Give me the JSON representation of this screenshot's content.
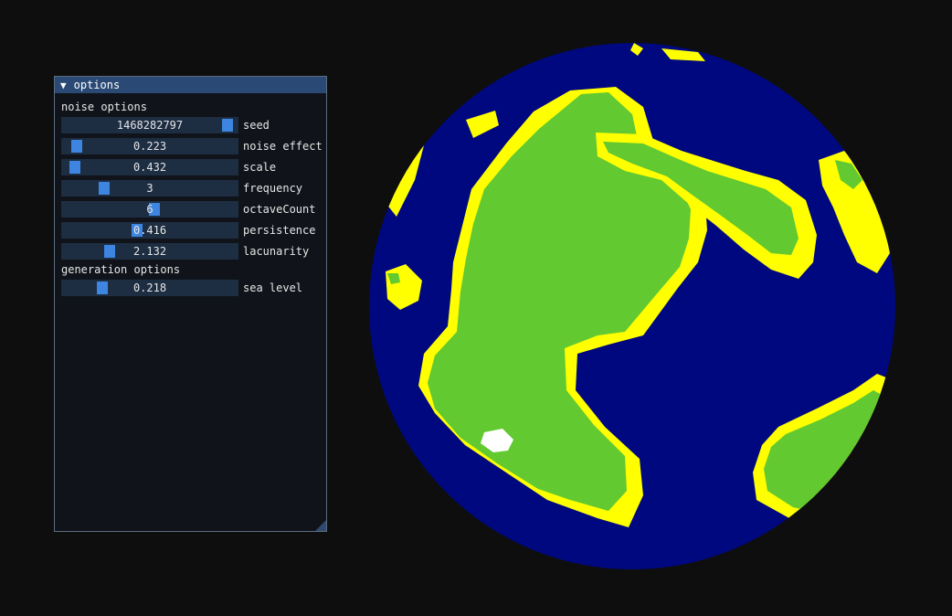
{
  "window": {
    "title": "options",
    "collapse_icon": "triangle-down-icon"
  },
  "noise_section": {
    "label": "noise options"
  },
  "generation_section": {
    "label": "generation options"
  },
  "sliders": [
    {
      "id": "seed",
      "label": "seed",
      "value": "1468282797",
      "fraction": 0.98
    },
    {
      "id": "noise-effect",
      "label": "noise effect",
      "value": "0.223",
      "fraction": 0.05
    },
    {
      "id": "scale",
      "label": "scale",
      "value": "0.432",
      "fraction": 0.04
    },
    {
      "id": "frequency",
      "label": "frequency",
      "value": "3",
      "fraction": 0.22
    },
    {
      "id": "octavecount",
      "label": "octaveCount",
      "value": "6",
      "fraction": 0.53
    },
    {
      "id": "persistence",
      "label": "persistence",
      "value": "0.416",
      "fraction": 0.42
    },
    {
      "id": "lacunarity",
      "label": "lacunarity",
      "value": "2.132",
      "fraction": 0.25
    },
    {
      "id": "sea-level",
      "label": "sea level",
      "value": "0.218",
      "fraction": 0.21
    }
  ],
  "colors": {
    "ocean": "#00087f",
    "beach": "#ffff00",
    "land": "#62c930",
    "snow": "#ffffff",
    "slider_bg": "#1d2d42",
    "slider_grab": "#3d85e0",
    "title_bar": "#2a4a75"
  }
}
